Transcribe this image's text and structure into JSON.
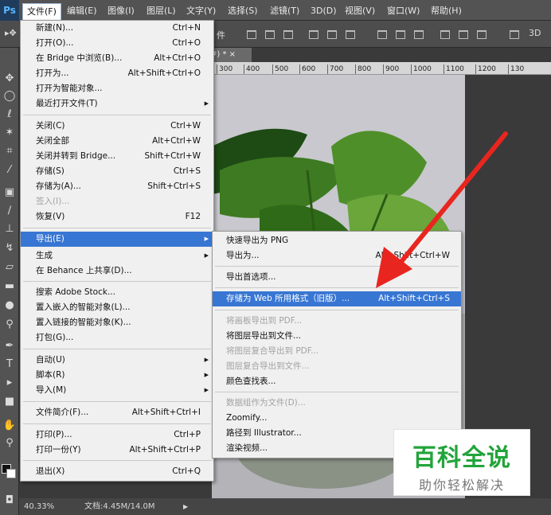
{
  "app": {
    "logo": "Ps"
  },
  "menubar": {
    "items": [
      "文件(F)",
      "编辑(E)",
      "图像(I)",
      "图层(L)",
      "文字(Y)",
      "选择(S)",
      "滤镜(T)",
      "3D(D)",
      "视图(V)",
      "窗口(W)",
      "帮助(H)"
    ],
    "active_index": 0
  },
  "optionsbar": {
    "label": "件"
  },
  "document": {
    "tab_fragment": "#) * ×"
  },
  "ruler": {
    "ticks": [
      "300",
      "400",
      "500",
      "600",
      "700",
      "800",
      "900",
      "1000",
      "1100",
      "1200",
      "130"
    ]
  },
  "file_menu": {
    "items": [
      {
        "label": "新建(N)...",
        "shortcut": "Ctrl+N"
      },
      {
        "label": "打开(O)...",
        "shortcut": "Ctrl+O"
      },
      {
        "label": "在 Bridge 中浏览(B)...",
        "shortcut": "Alt+Ctrl+O"
      },
      {
        "label": "打开为...",
        "shortcut": "Alt+Shift+Ctrl+O"
      },
      {
        "label": "打开为智能对象...",
        "shortcut": ""
      },
      {
        "label": "最近打开文件(T)",
        "shortcut": "",
        "submenu": true
      },
      {
        "label": "关闭(C)",
        "shortcut": "Ctrl+W"
      },
      {
        "label": "关闭全部",
        "shortcut": "Alt+Ctrl+W"
      },
      {
        "label": "关闭并转到 Bridge...",
        "shortcut": "Shift+Ctrl+W"
      },
      {
        "label": "存储(S)",
        "shortcut": "Ctrl+S"
      },
      {
        "label": "存储为(A)...",
        "shortcut": "Shift+Ctrl+S"
      },
      {
        "label": "签入(I)...",
        "shortcut": "",
        "disabled": true
      },
      {
        "label": "恢复(V)",
        "shortcut": "F12"
      },
      {
        "label": "导出(E)",
        "shortcut": "",
        "submenu": true,
        "highlighted": true
      },
      {
        "label": "生成",
        "shortcut": "",
        "submenu": true
      },
      {
        "label": "在 Behance 上共享(D)...",
        "shortcut": ""
      },
      {
        "label": "搜索 Adobe Stock...",
        "shortcut": ""
      },
      {
        "label": "置入嵌入的智能对象(L)...",
        "shortcut": ""
      },
      {
        "label": "置入链接的智能对象(K)...",
        "shortcut": ""
      },
      {
        "label": "打包(G)...",
        "shortcut": ""
      },
      {
        "label": "自动(U)",
        "shortcut": "",
        "submenu": true
      },
      {
        "label": "脚本(R)",
        "shortcut": "",
        "submenu": true
      },
      {
        "label": "导入(M)",
        "shortcut": "",
        "submenu": true
      },
      {
        "label": "文件简介(F)...",
        "shortcut": "Alt+Shift+Ctrl+I"
      },
      {
        "label": "打印(P)...",
        "shortcut": "Ctrl+P"
      },
      {
        "label": "打印一份(Y)",
        "shortcut": "Alt+Shift+Ctrl+P"
      },
      {
        "label": "退出(X)",
        "shortcut": "Ctrl+Q"
      }
    ]
  },
  "export_menu": {
    "items": [
      {
        "label": "快速导出为 PNG",
        "shortcut": ""
      },
      {
        "label": "导出为...",
        "shortcut": "Alt+Shift+Ctrl+W"
      },
      {
        "label": "导出首选项...",
        "shortcut": ""
      },
      {
        "label": "存储为 Web 所用格式（旧版）...",
        "shortcut": "Alt+Shift+Ctrl+S",
        "highlighted": true
      },
      {
        "label": "将画板导出到 PDF...",
        "shortcut": "",
        "disabled": true
      },
      {
        "label": "将图层导出到文件...",
        "shortcut": ""
      },
      {
        "label": "将图层复合导出到 PDF...",
        "shortcut": "",
        "disabled": true
      },
      {
        "label": "图层复合导出到文件...",
        "shortcut": "",
        "disabled": true
      },
      {
        "label": "颜色查找表...",
        "shortcut": ""
      },
      {
        "label": "数据组作为文件(D)...",
        "shortcut": "",
        "disabled": true
      },
      {
        "label": "Zoomify...",
        "shortcut": ""
      },
      {
        "label": "路径到 Illustrator...",
        "shortcut": ""
      },
      {
        "label": "渲染视频...",
        "shortcut": ""
      }
    ]
  },
  "statusbar": {
    "zoom": "40.33%",
    "doc_info": "文档:4.45M/14.0M"
  },
  "watermark": {
    "title": "百科全说",
    "subtitle": "助你轻松解决"
  },
  "colors": {
    "highlight": "#3876d3",
    "menu_bg": "#f0f0f0",
    "arrow": "#e8261f",
    "watermark_green": "#22a43a"
  }
}
